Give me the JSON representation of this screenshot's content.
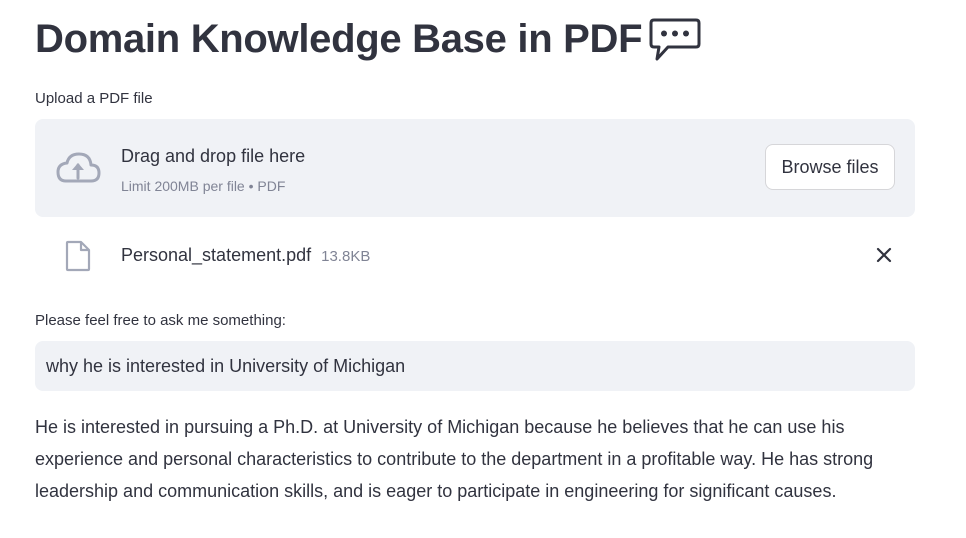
{
  "header": {
    "title": "Domain Knowledge Base in PDF",
    "title_icon": "speech-bubble-icon"
  },
  "uploader": {
    "label": "Upload a PDF file",
    "drop_text": "Drag and drop file here",
    "limit_text": "Limit 200MB per file • PDF",
    "browse_label": "Browse files",
    "icon": "cloud-upload-icon"
  },
  "uploaded_file": {
    "name": "Personal_statement.pdf",
    "size": "13.8KB",
    "icon": "file-icon",
    "remove_icon": "close-icon"
  },
  "question": {
    "label": "Please feel free to ask me something:",
    "value": "why he is interested in University of Michigan"
  },
  "answer": {
    "text": "He is interested in pursuing a Ph.D. at University of Michigan because he believes that he can use his experience and personal characteristics to contribute to the department in a profitable way. He has strong leadership and communication skills, and is eager to participate in engineering for significant causes."
  },
  "colors": {
    "text": "#31333f",
    "muted": "#808495",
    "input_bg": "#f0f2f6",
    "icon": "#a3a8b8"
  }
}
